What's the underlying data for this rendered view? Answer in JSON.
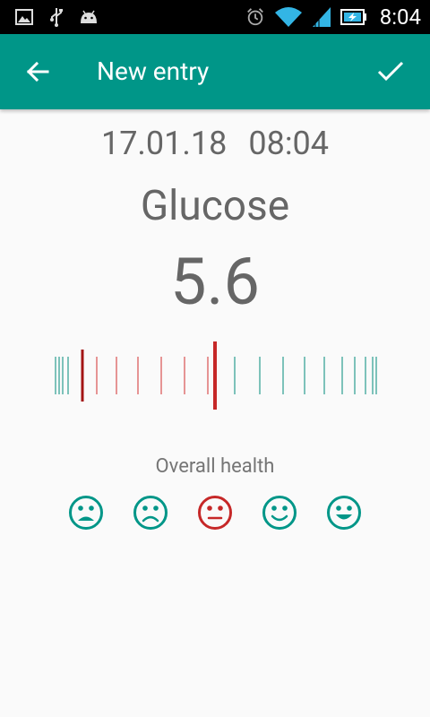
{
  "status_bar": {
    "time": "8:04",
    "left_icons": [
      "image-icon",
      "usb-icon",
      "android-icon"
    ],
    "right_icons": [
      "alarm-icon",
      "wifi-icon",
      "signal-icon",
      "battery-charging-icon"
    ]
  },
  "app_bar": {
    "title": "New entry",
    "color": "#009688"
  },
  "entry": {
    "date": "17.01.18",
    "time": "08:04",
    "category": "Glucose",
    "value": "5.6"
  },
  "ruler": {
    "selected_color": "#c62828",
    "in_range_color": "#d32f2f",
    "out_of_range_color": "#00897b"
  },
  "health": {
    "label": "Overall health",
    "options": [
      "very-sad-face-icon",
      "sad-face-icon",
      "neutral-face-icon",
      "happy-face-icon",
      "very-happy-face-icon"
    ],
    "selected_index": 2,
    "selected_color": "#c62828",
    "default_color": "#009688"
  }
}
